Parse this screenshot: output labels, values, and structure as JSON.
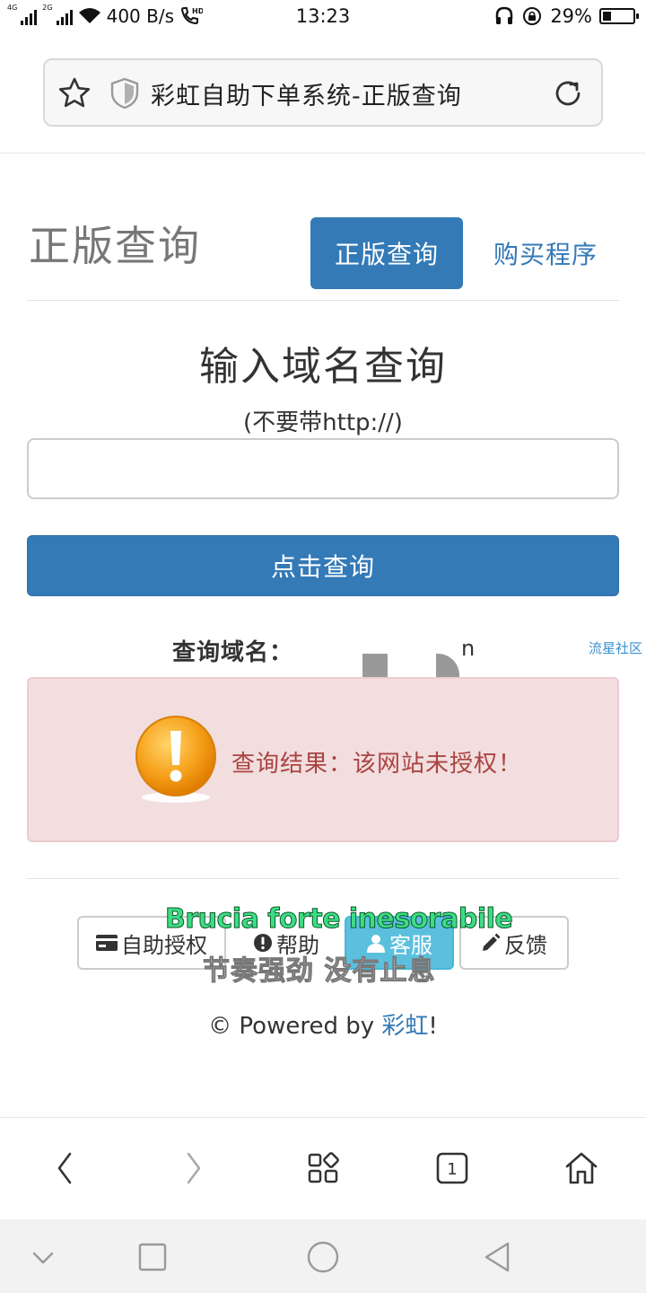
{
  "status_bar": {
    "net_left": "4G",
    "net_right": "2G",
    "speed": "400 B/s",
    "volte": "HD",
    "time": "13:23",
    "battery": "29%",
    "battery_level": 0.29
  },
  "browser": {
    "page_title": "彩虹自助下单系统-正版查询"
  },
  "page": {
    "title": "正版查询",
    "tab_active": "正版查询",
    "tab_link": "购买程序",
    "heading": "输入域名查询",
    "hint": "(不要带http://)",
    "domain_input": {
      "value": "",
      "placeholder": ""
    },
    "query_button": "点击查询",
    "query_label": "查询域名：",
    "query_value": "n",
    "watermark": "流星社区",
    "result_text": "查询结果：该网站未授权！",
    "footer_buttons": {
      "auth": "自助授权",
      "help": "帮助",
      "service": "客服",
      "feedback": "反馈"
    },
    "footer_prefix": "© Powered by ",
    "footer_brand": "彩虹",
    "footer_suffix": "!"
  },
  "overlay_subtitles": {
    "line1": "Brucia forte inesorabile",
    "line2": "节奏强劲 没有止息"
  },
  "bottom_bar": {
    "tab_count": "1"
  },
  "colors": {
    "primary": "#337ab7",
    "alert_bg": "#f2dede",
    "alert_text": "#a94442",
    "info": "#5bc0de"
  }
}
